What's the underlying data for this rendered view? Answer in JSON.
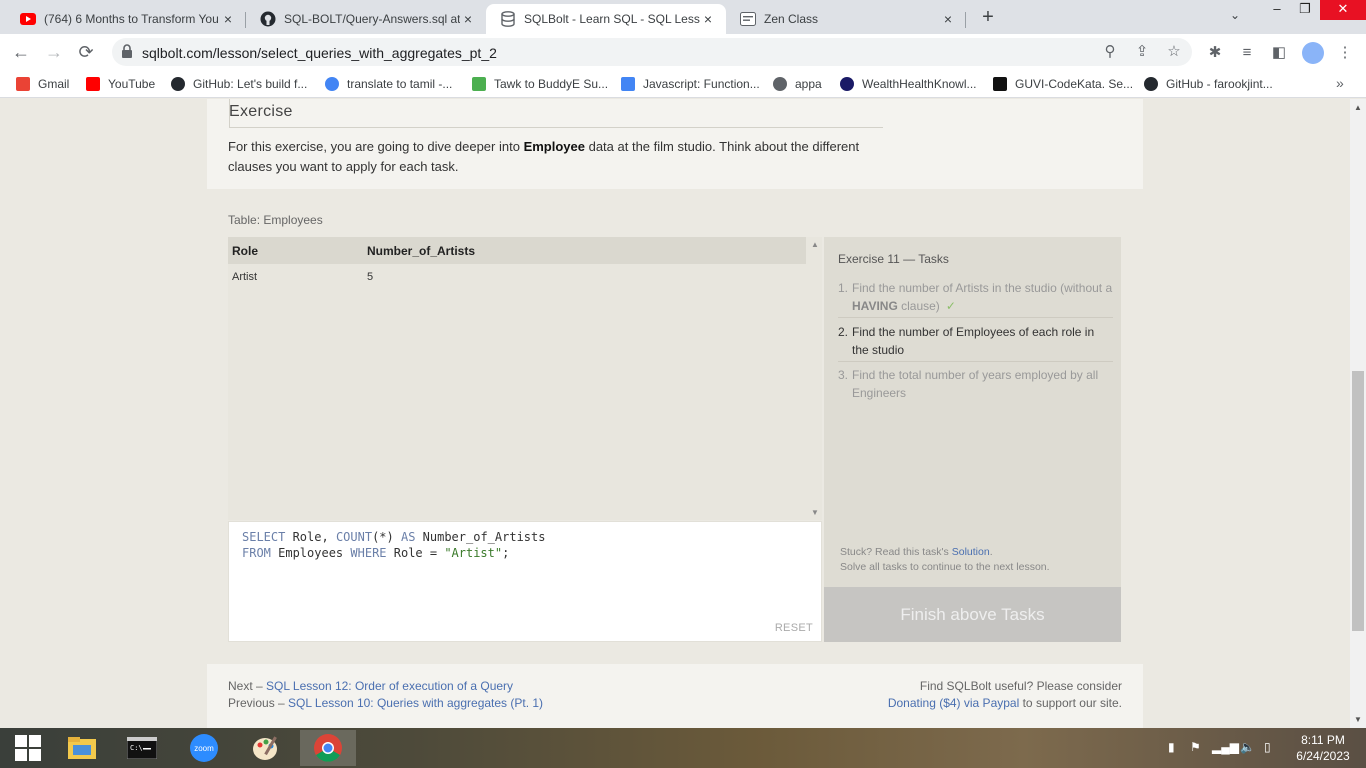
{
  "browser": {
    "tabs": [
      {
        "title": "(764) 6 Months to Transform You",
        "icon": "youtube-icon"
      },
      {
        "title": "SQL-BOLT/Query-Answers.sql at",
        "icon": "github-icon"
      },
      {
        "title": "SQLBolt - Learn SQL - SQL Lesso",
        "icon": "sqlbolt-icon"
      },
      {
        "title": "Zen Class",
        "icon": "zen-class-icon"
      }
    ],
    "url": "sqlbolt.com/lesson/select_queries_with_aggregates_pt_2",
    "bookmarks": [
      {
        "label": "Gmail",
        "color": "#ea4335"
      },
      {
        "label": "YouTube",
        "color": "#ff0000"
      },
      {
        "label": "GitHub: Let's build f...",
        "color": "#24292f"
      },
      {
        "label": "translate to tamil -...",
        "color": "#4285f4"
      },
      {
        "label": "Tawk to BuddyE Su...",
        "color": "#4caf50"
      },
      {
        "label": "Javascript: Function...",
        "color": "#4285f4"
      },
      {
        "label": "appa",
        "color": "#5f6368"
      },
      {
        "label": "WealthHealthKnowl...",
        "color": "#1a1a66"
      },
      {
        "label": "GUVI-CodeKata. Se...",
        "color": "#111111"
      },
      {
        "label": "GitHub - farookjint...",
        "color": "#24292f"
      }
    ]
  },
  "exercise": {
    "heading": "Exercise",
    "desc_before": "For this exercise, you are going to dive deeper into ",
    "desc_bold": "Employee",
    "desc_after": " data at the film studio. Think about the different clauses you want to apply for each task."
  },
  "table": {
    "label": "Table: Employees",
    "columns": [
      "Role",
      "Number_of_Artists"
    ],
    "rows": [
      [
        "Artist",
        "5"
      ]
    ]
  },
  "editor": {
    "line1": {
      "kw1": "SELECT",
      "t1": " Role, ",
      "kw2": "COUNT",
      "t2": "(*) ",
      "kw3": "AS",
      "t3": " Number_of_Artists"
    },
    "line2": {
      "kw1": "FROM",
      "t1": " Employees ",
      "kw2": "WHERE",
      "t2": " Role = ",
      "str": "\"Artist\"",
      "t3": ";"
    },
    "reset": "RESET"
  },
  "tasks": {
    "title": "Exercise 11 — Tasks",
    "items": [
      {
        "num": "1.",
        "text_a": "Find the number of Artists in the studio (without a ",
        "bold": "HAVING",
        "text_b": " clause)",
        "check": "✓"
      },
      {
        "num": "2.",
        "text": "Find the number of Employees of each role in the studio"
      },
      {
        "num": "3.",
        "text": "Find the total number of years employed by all Engineers"
      }
    ],
    "stuck_before": "Stuck? Read this task's ",
    "stuck_link": "Solution",
    "stuck_after": ".",
    "stuck_line2": "Solve all tasks to continue to the next lesson.",
    "finish": "Finish above Tasks"
  },
  "footer": {
    "next_prefix": "Next – ",
    "next_link": "SQL Lesson 12: Order of execution of a Query",
    "prev_prefix": "Previous – ",
    "prev_link": "SQL Lesson 10: Queries with aggregates (Pt. 1)",
    "right_line1": "Find SQLBolt useful? Please consider",
    "right_link": "Donating ($4) via Paypal",
    "right_after": " to support our site."
  },
  "taskbar": {
    "time": "8:11 PM",
    "date": "6/24/2023",
    "zoom_label": "zoom"
  }
}
